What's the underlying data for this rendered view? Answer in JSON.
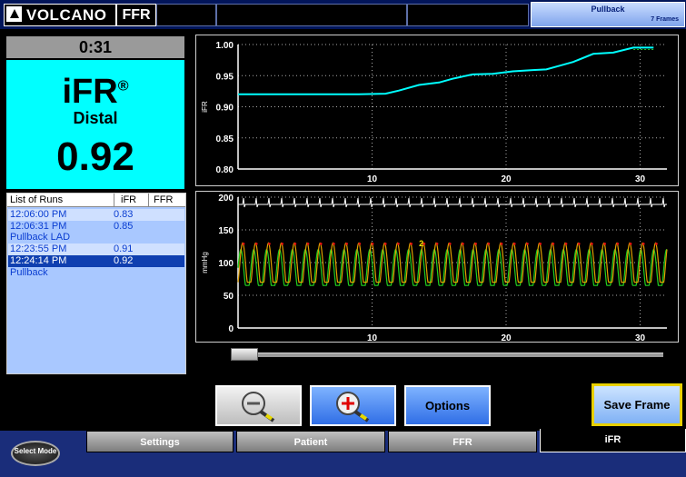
{
  "topbar": {
    "brand": "VOLCANO",
    "product": "FFR",
    "mode_title": "Pullback",
    "frames": "7 Frames"
  },
  "left": {
    "timer": "0:31",
    "index_name": "iFR",
    "index_sup": "®",
    "location": "Distal",
    "value": "0.92"
  },
  "runs": {
    "headers": {
      "list": "List of Runs",
      "ifr": "iFR",
      "ffr": "FFR"
    },
    "rows": [
      {
        "time": "12:06:00 PM",
        "ifr": "0.83",
        "selected": false,
        "alt": true
      },
      {
        "time": "12:06:31 PM",
        "ifr": "0.85",
        "label": "Pullback LAD",
        "selected": false
      },
      {
        "time": "12:23:55 PM",
        "ifr": "0.91",
        "selected": false,
        "alt": true
      },
      {
        "time": "12:24:14 PM",
        "ifr": "0.92",
        "label": "Pullback",
        "selected": true
      }
    ]
  },
  "colors": {
    "accent": "#00ffff",
    "pressure_aortic": "#e0a000",
    "pressure_distal": "#20d020",
    "ecg": "#ffffff"
  },
  "chart_data": [
    {
      "type": "line",
      "ylabel": "iFR",
      "ylim": [
        0.8,
        1.0
      ],
      "xlim": [
        0,
        32
      ],
      "yticks": [
        "1.00",
        "0.95",
        "0.90",
        "0.85",
        "0.80"
      ],
      "xticks": [
        "10",
        "20",
        "30"
      ],
      "grid": true,
      "series": [
        {
          "x": [
            0,
            3,
            6,
            9,
            11,
            12,
            13.5,
            15,
            16,
            17.5,
            19,
            20.5,
            22,
            23,
            24,
            25,
            26.5,
            28,
            29.5,
            31
          ],
          "values": [
            0.92,
            0.92,
            0.92,
            0.92,
            0.921,
            0.926,
            0.935,
            0.939,
            0.945,
            0.952,
            0.953,
            0.957,
            0.959,
            0.96,
            0.966,
            0.972,
            0.985,
            0.987,
            0.995,
            0.995
          ]
        }
      ]
    },
    {
      "type": "line",
      "ylabel": "mmHg",
      "ylim": [
        0,
        200
      ],
      "xlim": [
        0,
        32
      ],
      "yticks": [
        "200",
        "150",
        "100",
        "50",
        "0"
      ],
      "xticks": [
        "10",
        "20",
        "30"
      ],
      "marker": "2",
      "grid": true,
      "series": [
        {
          "values": [
            130,
            70
          ]
        },
        {
          "values": [
            120,
            65
          ]
        }
      ]
    }
  ],
  "buttons": {
    "options": "Options",
    "save_frame": "Save Frame",
    "select_mode": "Select Mode"
  },
  "tabs": [
    "Settings",
    "Patient",
    "FFR",
    "iFR"
  ],
  "slider": {
    "position": 0.0
  }
}
